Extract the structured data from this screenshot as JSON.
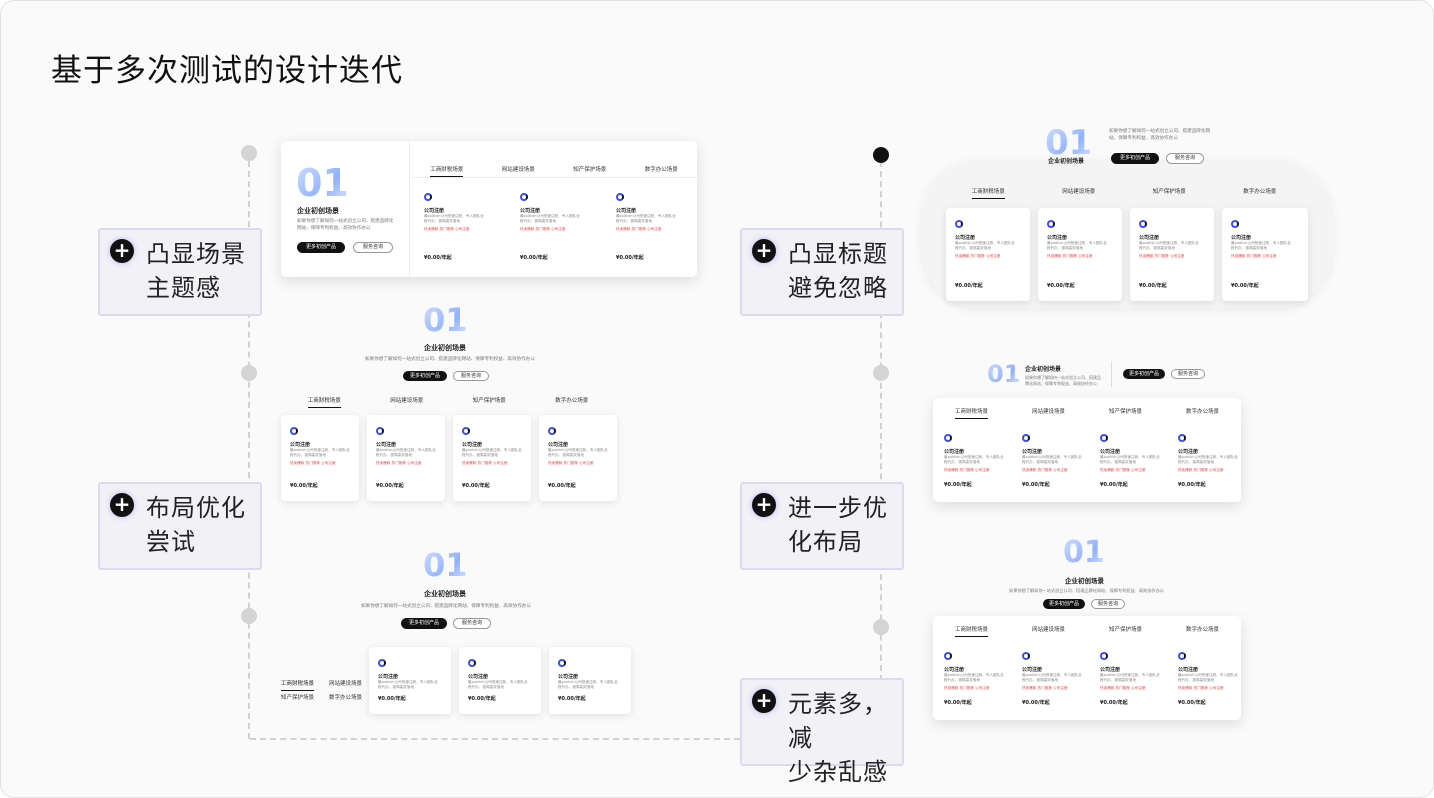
{
  "title": "基于多次测试的设计迭代",
  "notes": [
    {
      "line1": "凸显场景",
      "line2": "主题感"
    },
    {
      "line1": "布局优化",
      "line2": "尝试"
    },
    {
      "line1": "凸显标题",
      "line2": "避免忽略"
    },
    {
      "line1": "进一步优",
      "line2": "化布局"
    },
    {
      "line1": "元素多，减",
      "line2": "少杂乱感"
    }
  ],
  "mockup": {
    "number": "01",
    "scene_title": "企业初创场景",
    "scene_desc": "如果你想了解如何一站式创立公司、搭建品牌化网站、保障专利权益、高效协作办公",
    "primary_button": "更多初创产品",
    "secondary_button": "服务咨询",
    "tabs": [
      "工商财税场景",
      "网站建设场景",
      "知产保护场景",
      "数字办公场景"
    ],
    "card_title": "公司注册",
    "card_desc": "最publish公司快速注册、专人团队全程代办、极简高效落地",
    "card_tags": "热卖爆款  热门推荐  公司注册",
    "card_price": "¥0.00/年起"
  }
}
